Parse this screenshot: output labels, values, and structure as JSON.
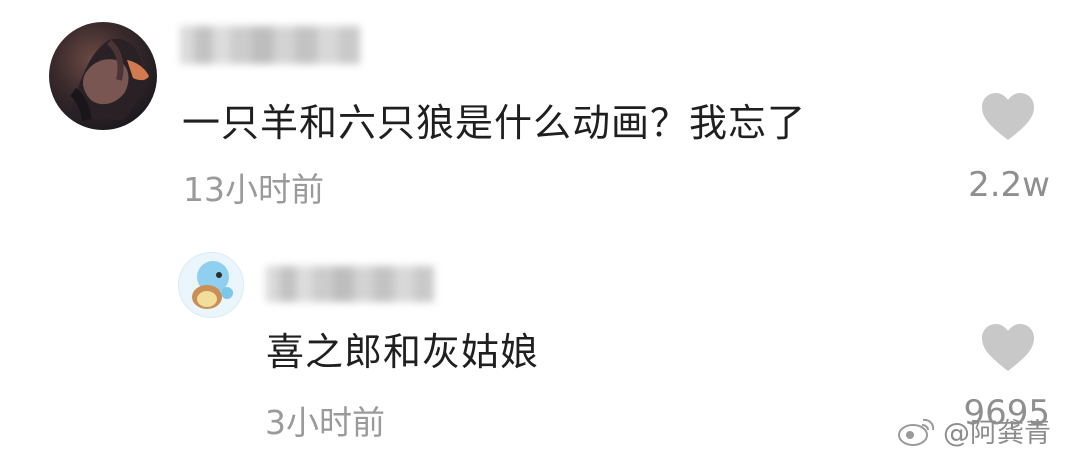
{
  "comments": [
    {
      "text": "一只羊和六只狼是什么动画？我忘了",
      "time": "13小时前",
      "likes": "2.2w",
      "reply": {
        "text": "喜之郎和灰姑娘",
        "time": "3小时前",
        "likes": "9695"
      }
    }
  ],
  "watermark": {
    "label": "@阿龚青"
  },
  "colors": {
    "text": "#1f1f1f",
    "meta": "#9a9a9a",
    "heart": "#c8c8c8"
  }
}
